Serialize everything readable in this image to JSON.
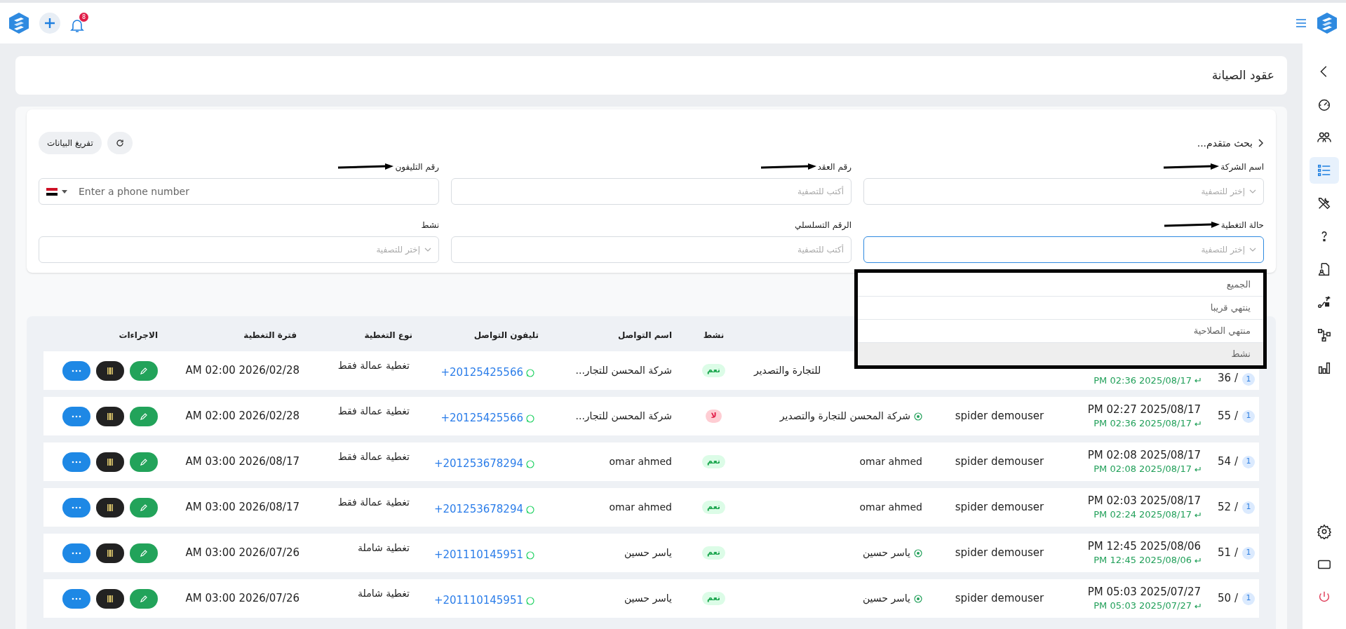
{
  "topbar": {
    "notification_count": "8"
  },
  "sidebar": {
    "items": [
      {
        "kind": "gauge",
        "selected": false
      },
      {
        "kind": "users",
        "selected": false
      },
      {
        "kind": "list",
        "selected": true
      },
      {
        "kind": "tools",
        "selected": false
      },
      {
        "kind": "question",
        "selected": false
      },
      {
        "kind": "document-user",
        "selected": false
      },
      {
        "kind": "route",
        "selected": false
      },
      {
        "kind": "hierarchy",
        "selected": false
      },
      {
        "kind": "bar-chart",
        "selected": false
      }
    ],
    "bottom_items": [
      {
        "kind": "settings"
      },
      {
        "kind": "tablet"
      },
      {
        "kind": "power"
      }
    ]
  },
  "page": {
    "title": "عقود الصيانة"
  },
  "filters": {
    "title": "بحث متقدم...",
    "clear_button": "تفريغ البيانات",
    "fields": [
      {
        "kind": "select",
        "label": "اسم الشركة",
        "placeholder": "إختر للتصفية",
        "focused": false,
        "annotated": true
      },
      {
        "kind": "text",
        "label": "رقم العقد",
        "placeholder": "أكتب للتصفية",
        "focused": false,
        "annotated": true
      },
      {
        "kind": "phone",
        "label": "رقم التليفون",
        "placeholder": "Enter a phone number",
        "focused": false,
        "annotated": true
      },
      {
        "kind": "select",
        "label": "حالة التغطية",
        "placeholder": "إختر للتصفية",
        "focused": true,
        "annotated": true
      },
      {
        "kind": "text",
        "label": "الرقم التسلسلي",
        "placeholder": "أكتب للتصفية",
        "focused": false,
        "annotated": false
      },
      {
        "kind": "select",
        "label": "نشط",
        "placeholder": "إختر للتصفية",
        "focused": false,
        "annotated": false
      }
    ]
  },
  "dropdown": {
    "options": [
      {
        "label": "الجميع",
        "highlighted": false
      },
      {
        "label": "ينتهي قريبا",
        "highlighted": false
      },
      {
        "label": "منتهي الصلاحية",
        "highlighted": false
      },
      {
        "label": "نشط",
        "highlighted": true
      }
    ]
  },
  "table": {
    "columns": [
      "نشط",
      "اسم التواصل",
      "تليفون التواصل",
      "نوع التغطية",
      "فترة التغطية",
      "الاجراءات"
    ],
    "rows": [
      {
        "kind": "partly-covered",
        "number": "36 /",
        "badge": "1",
        "created_sub": "PM 02:36 2025/08/17",
        "client": "للتجارة والتصدير",
        "linked": false,
        "active": true,
        "active_label": "نعم",
        "contact": "شركة المحسن للتجار...",
        "phone": "+20125425566",
        "coverage_type": "تغطية عمالة فقط",
        "period": "AM 02:00 2026/02/28"
      },
      {
        "kind": "full",
        "number": "55 /",
        "badge": "1",
        "created": "PM 02:27 2025/08/17",
        "created_sub": "PM 02:36 2025/08/17",
        "member": "spider demouser",
        "client": "شركة المحسن للتجارة والتصدير",
        "linked": true,
        "active": false,
        "active_label": "لا",
        "contact": "شركة المحسن للتجار...",
        "phone": "+20125425566",
        "coverage_type": "تغطية عمالة فقط",
        "period": "AM 02:00 2026/02/28"
      },
      {
        "kind": "full",
        "number": "54 /",
        "badge": "1",
        "created": "PM 02:08 2025/08/17",
        "created_sub": "PM 02:08 2025/08/17",
        "member": "spider demouser",
        "client": "omar ahmed",
        "linked": false,
        "active": true,
        "active_label": "نعم",
        "contact": "omar ahmed",
        "phone": "+201253678294",
        "coverage_type": "تغطية عمالة فقط",
        "period": "AM 03:00 2026/08/17"
      },
      {
        "kind": "full",
        "number": "52 /",
        "badge": "1",
        "created": "PM 02:03 2025/08/17",
        "created_sub": "PM 02:24 2025/08/17",
        "member": "spider demouser",
        "client": "omar ahmed",
        "linked": false,
        "active": true,
        "active_label": "نعم",
        "contact": "omar ahmed",
        "phone": "+201253678294",
        "coverage_type": "تغطية عمالة فقط",
        "period": "AM 03:00 2026/08/17"
      },
      {
        "kind": "full",
        "number": "51 /",
        "badge": "1",
        "created": "PM 12:45 2025/08/06",
        "created_sub": "PM 12:45 2025/08/06",
        "member": "spider demouser",
        "client": "ياسر حسين",
        "linked": true,
        "active": true,
        "active_label": "نعم",
        "contact": "ياسر حسين",
        "phone": "+201110145951",
        "coverage_type": "تغطية شاملة",
        "period": "AM 03:00 2026/07/26"
      },
      {
        "kind": "full",
        "number": "50 /",
        "badge": "1",
        "created": "PM 05:03 2025/07/27",
        "created_sub": "PM 05:03 2025/07/27",
        "member": "spider demouser",
        "client": "ياسر حسين",
        "linked": true,
        "active": true,
        "active_label": "نعم",
        "contact": "ياسر حسين",
        "phone": "+201110145951",
        "coverage_type": "تغطية شاملة",
        "period": "AM 03:00 2026/07/26"
      }
    ]
  }
}
